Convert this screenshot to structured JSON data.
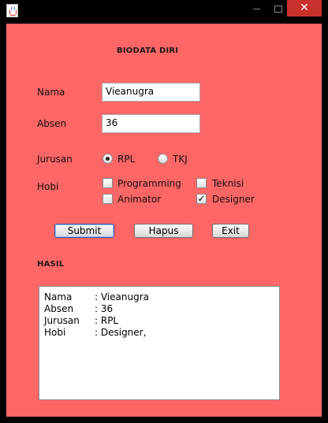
{
  "window": {
    "close_glyph": "✕"
  },
  "form": {
    "heading": "BIODATA DIRI",
    "nama_label": "Nama",
    "nama_value": "Vieanugra",
    "absen_label": "Absen",
    "absen_value": "36",
    "jurusan_label": "Jurusan",
    "jurusan_options": [
      "RPL",
      "TKJ"
    ],
    "jurusan_selected": "RPL",
    "hobi_label": "Hobi",
    "hobi_options": [
      {
        "label": "Programming",
        "checked": false
      },
      {
        "label": "Teknisi",
        "checked": false
      },
      {
        "label": "Animator",
        "checked": false
      },
      {
        "label": "Designer",
        "checked": true
      }
    ],
    "check_glyph": "✓",
    "submit_label": "Submit",
    "hapus_label": "Hapus",
    "exit_label": "Exit"
  },
  "hasil": {
    "heading": "HASIL",
    "lines": [
      {
        "key": "Nama",
        "value": ": Vieanugra"
      },
      {
        "key": "Absen",
        "value": ": 36"
      },
      {
        "key": "Jurusan",
        "value": ": RPL"
      },
      {
        "key": "Hobi",
        "value": ": Designer,"
      }
    ]
  },
  "colors": {
    "panel_bg": "#ff6666",
    "titlebar_bg": "#000000",
    "close_bg": "#c9312c"
  },
  "icons": [
    "java-app-icon",
    "minimize-icon",
    "maximize-icon",
    "close-icon"
  ]
}
